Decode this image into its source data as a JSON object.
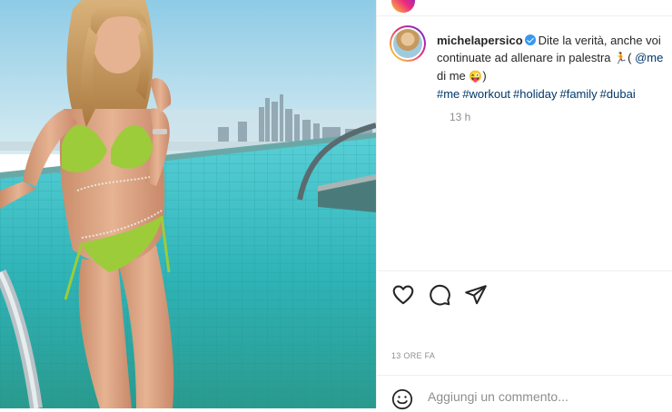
{
  "post": {
    "username": "michelapersico",
    "caption_line1": "Dite la verità, anche voi",
    "caption_line2": "continuate ad allenare in palestra",
    "caption_mention": "@me",
    "caption_line3": "di me",
    "running_emoji": "🏃",
    "paren_open": "(",
    "paren_close": ")",
    "laugh_emoji": "😜",
    "hashtags": [
      "#me",
      "#workout",
      "#holiday",
      "#family",
      "#dubai"
    ],
    "time_short": "13 h",
    "time_long": "13 ORE FA"
  },
  "comment": {
    "placeholder": "Aggiungi un commento..."
  },
  "icons": {
    "like": "heart-icon",
    "comment": "comment-bubble-icon",
    "share": "paper-plane-icon",
    "emoji": "smiley-icon",
    "verified": "verified-badge-icon"
  },
  "colors": {
    "link": "#00376b",
    "verified": "#3897f0",
    "muted": "#8e8e8e",
    "pool": "#2fb4b8",
    "bikini": "#9ccc3a"
  }
}
